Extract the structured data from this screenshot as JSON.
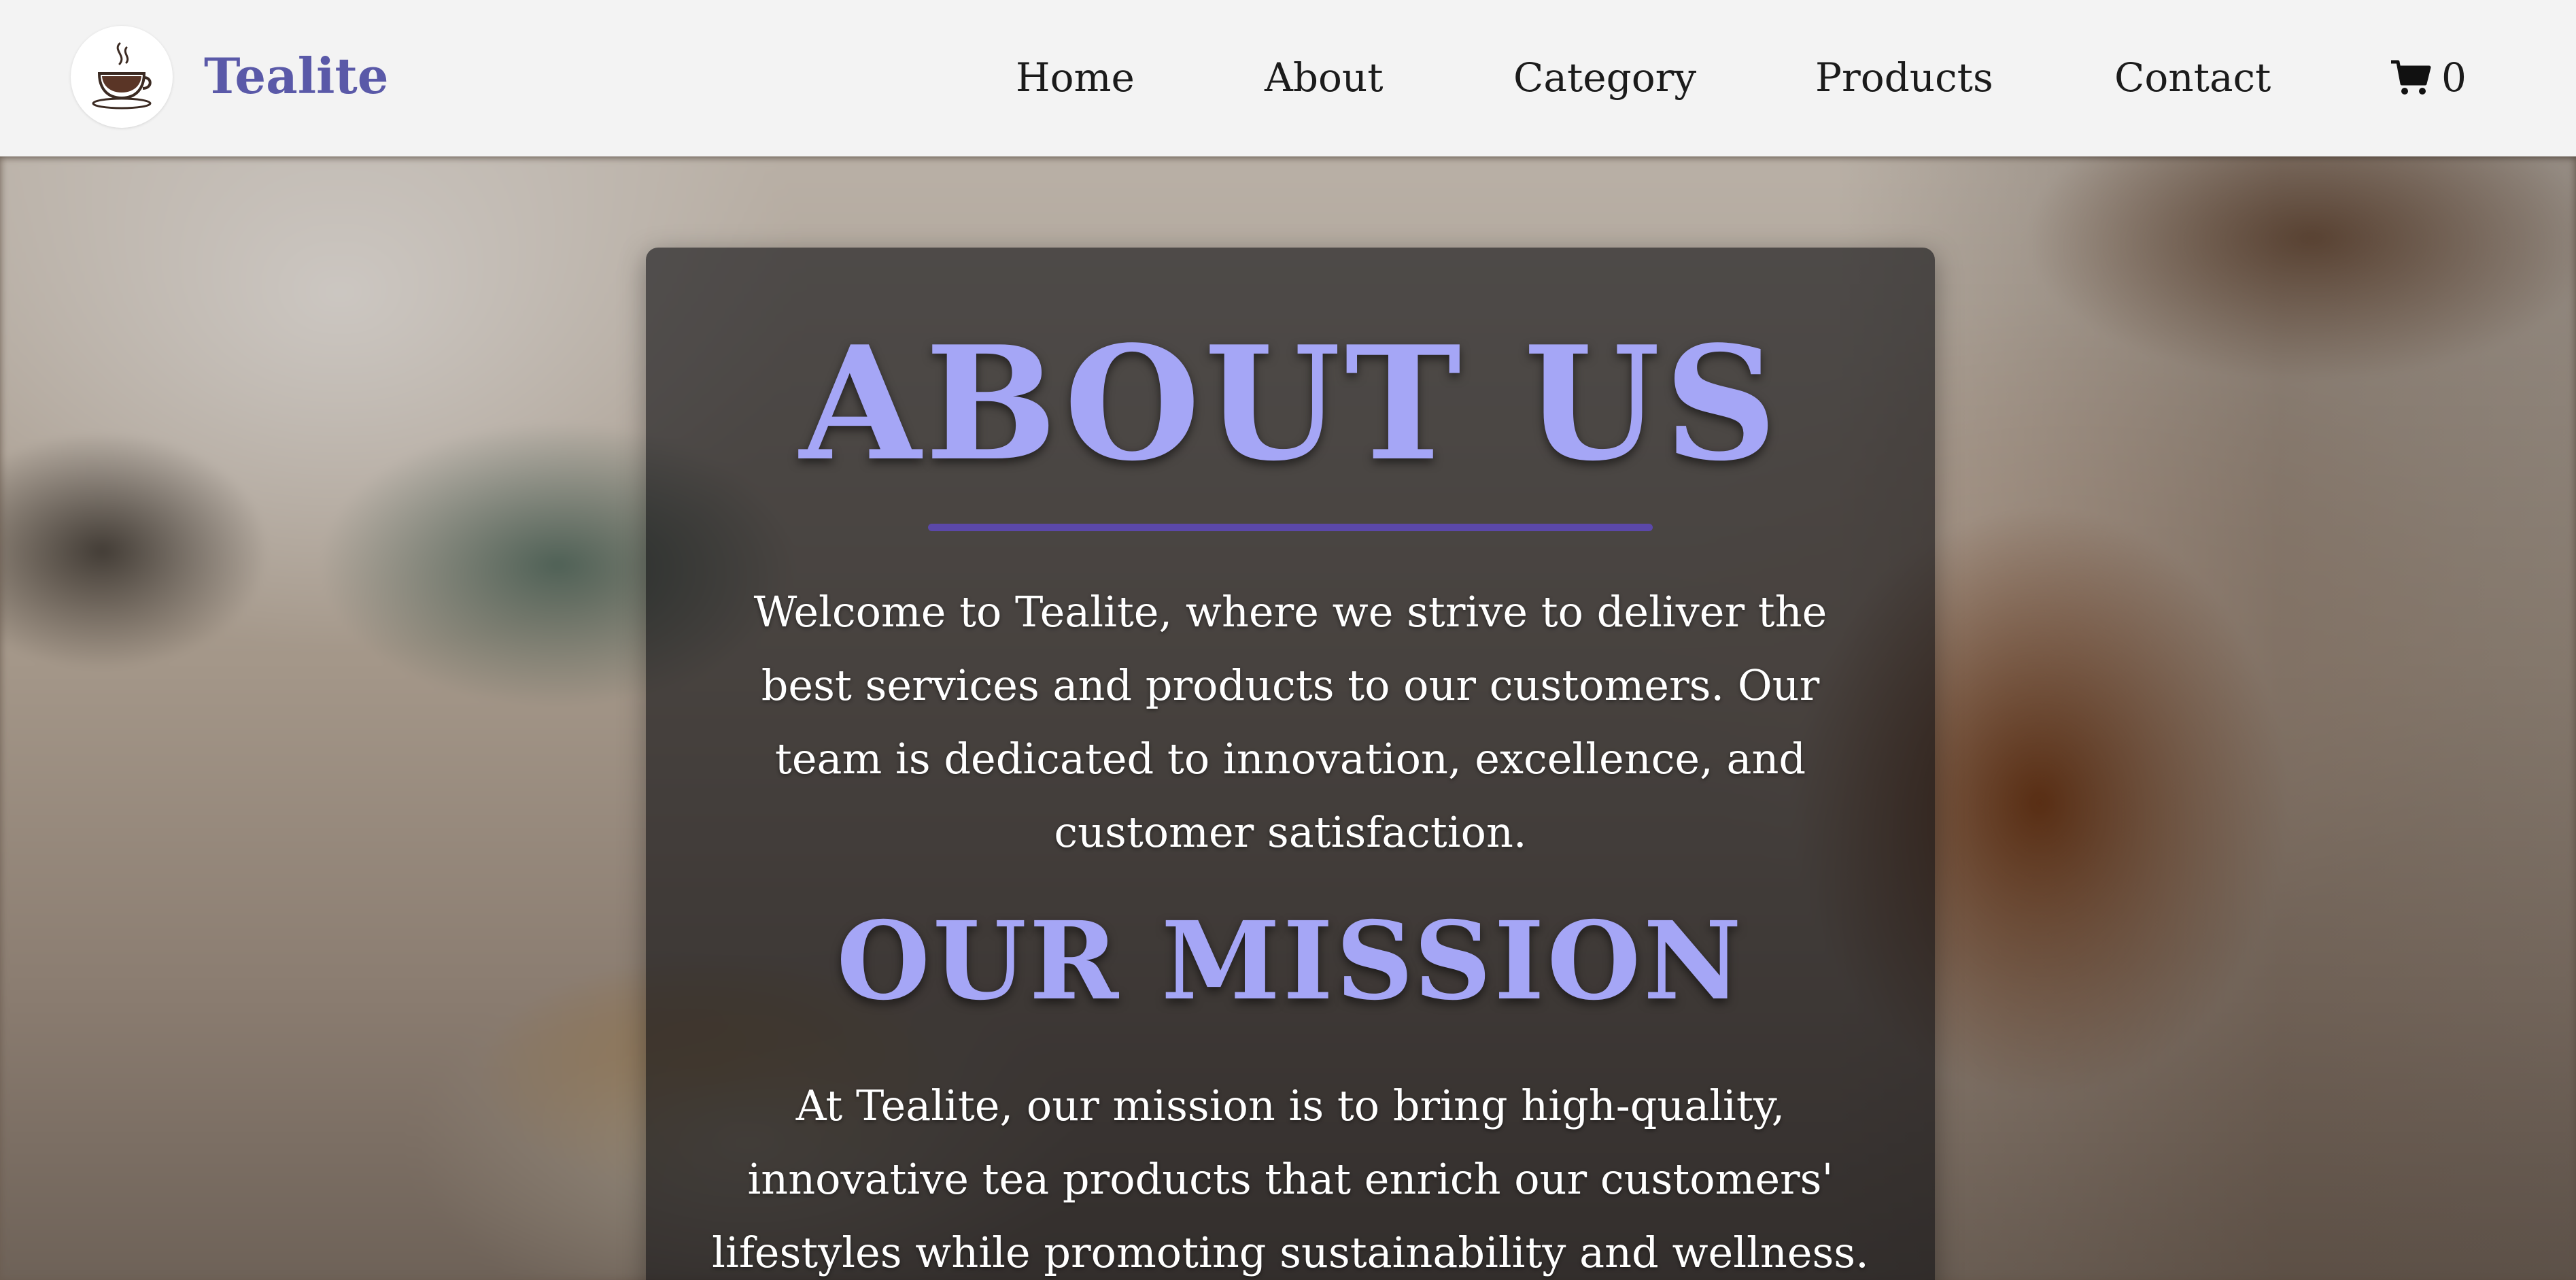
{
  "navbar": {
    "brand": "Tealite",
    "links": [
      "Home",
      "About",
      "Category",
      "Products",
      "Contact"
    ],
    "cart_count": "0"
  },
  "about": {
    "title": "ABOUT US",
    "text": "Welcome to Tealite, where we strive to deliver the best services and products to our customers. Our team is dedicated to innovation, excellence, and customer satisfaction."
  },
  "mission": {
    "title": "OUR MISSION",
    "text": "At Tealite, our mission is to bring high-quality, innovative tea products that enrich our customers' lifestyles while promoting sustainability and wellness."
  },
  "icons": {
    "logo": "teacup-icon",
    "cart": "cart-icon"
  },
  "colors": {
    "brand": "#5a59a8",
    "heading": "#a5a6f6",
    "rule": "#5b48a9",
    "navbar_bg": "#f3f3f3"
  }
}
